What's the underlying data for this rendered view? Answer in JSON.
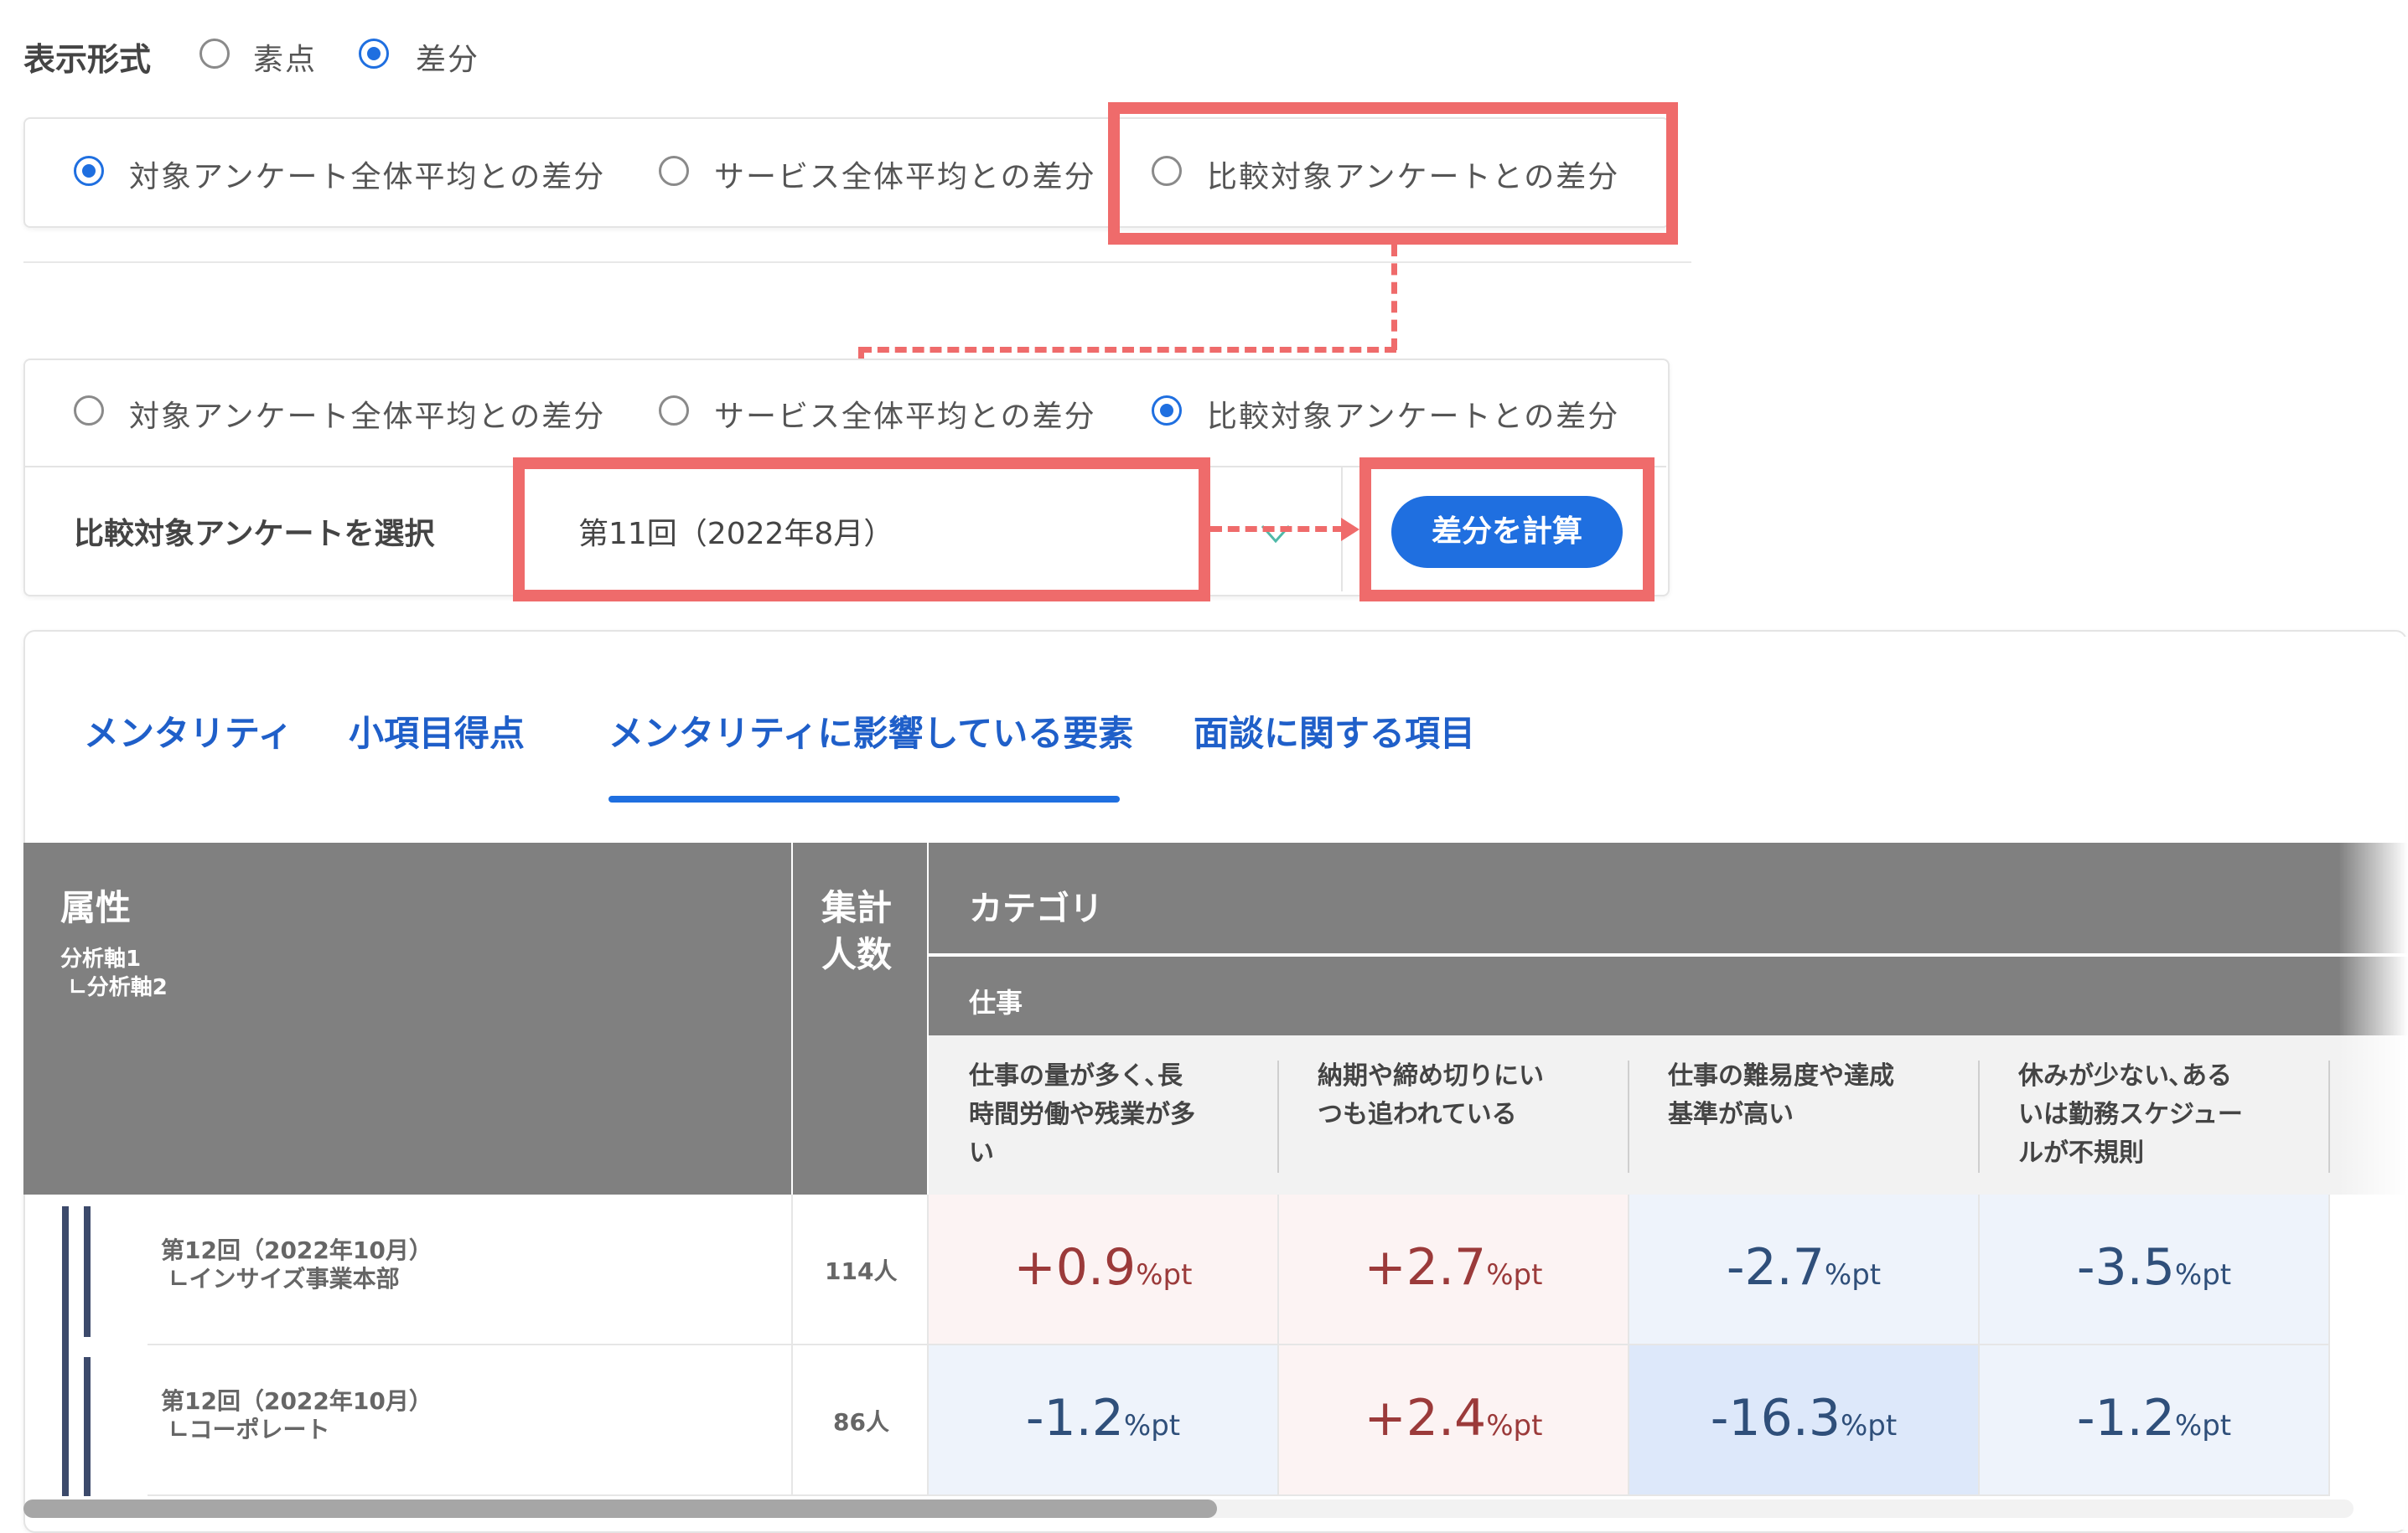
{
  "display_format": {
    "label": "表示形式",
    "options": [
      {
        "label": "素点",
        "selected": false
      },
      {
        "label": "差分",
        "selected": true
      }
    ]
  },
  "diff_options_top": [
    {
      "label": "対象アンケート全体平均との差分",
      "selected": true
    },
    {
      "label": "サービス全体平均との差分",
      "selected": false
    },
    {
      "label": "比較対象アンケートとの差分",
      "selected": false
    }
  ],
  "diff_options_bottom": [
    {
      "label": "対象アンケート全体平均との差分",
      "selected": false
    },
    {
      "label": "サービス全体平均との差分",
      "selected": false
    },
    {
      "label": "比較対象アンケートとの差分",
      "selected": true
    }
  ],
  "compare_select": {
    "label": "比較対象アンケートを選択",
    "value": "第11回（2022年8月）",
    "button": "差分を計算"
  },
  "tabs": [
    {
      "label": "メンタリティ",
      "active": false
    },
    {
      "label": "小項目得点",
      "active": false
    },
    {
      "label": "メンタリティに影響している要素",
      "active": true
    },
    {
      "label": "面談に関する項目",
      "active": false
    }
  ],
  "table": {
    "attr_header": "属性",
    "attr_axis1": "分析軸1",
    "attr_axis2": "∟分析軸2",
    "count_header_line1": "集計",
    "count_header_line2": "人数",
    "category_header": "カテゴリ",
    "subcategory": "仕事",
    "columns": [
      [
        "仕事の量が多く､長",
        "時間労働や残業が多",
        "い"
      ],
      [
        "納期や締め切りにい",
        "つも追われている"
      ],
      [
        "仕事の難易度や達成",
        "基準が高い"
      ],
      [
        "休みが少ない､ある",
        "いは勤務スケジュー",
        "ルが不規則"
      ]
    ],
    "unit": "%pt",
    "rows": [
      {
        "label1": "第12回（2022年10月）",
        "label2": "∟インサイズ事業本部",
        "count": "114人",
        "values": [
          "+0.9",
          "+2.7",
          "-2.7",
          "-3.5"
        ]
      },
      {
        "label1": "第12回（2022年10月）",
        "label2": "∟コーポレート",
        "count": "86人",
        "values": [
          "-1.2",
          "+2.4",
          "-16.3",
          "-1.2"
        ]
      }
    ]
  },
  "colors": {
    "accent": "#1f6fe0",
    "highlight": "#ef6b6b",
    "header_gray": "#808080",
    "positive_bg": "#fcf3f3",
    "negative_bg": "#eef3fb",
    "strong_negative_bg": "#dde8fa"
  }
}
